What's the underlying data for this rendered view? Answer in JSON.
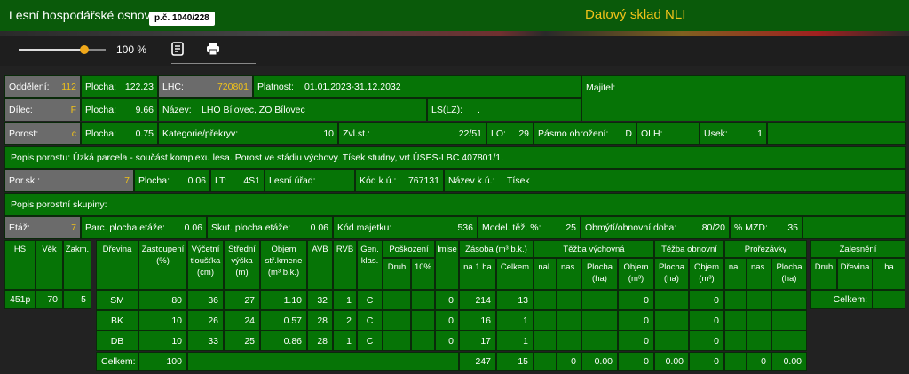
{
  "header": {
    "app_title": "Lesní hospodářské osnovy",
    "ref_badge": "p.č. 1040/228",
    "data_title": "Datový sklad NLI"
  },
  "toolbar": {
    "zoom": "100 %",
    "zoom_level": 1.0,
    "notes_icon": "notes-icon",
    "print_icon": "printer-icon"
  },
  "colors": {
    "accent": "#f0c21a",
    "cell": "#067406",
    "label_cell": "#6b6b6b"
  },
  "info": {
    "oddeleni_label": "Oddělení:",
    "oddeleni": "112",
    "plocha1_label": "Plocha:",
    "plocha1": "122.23",
    "lhc_label": "LHC:",
    "lhc": "720801",
    "platnost_label": "Platnost:",
    "platnost": "01.01.2023-31.12.2032",
    "majitel_label": "Majitel:",
    "dilec_label": "Dílec:",
    "dilec": "F",
    "plocha2_label": "Plocha:",
    "plocha2": "9.66",
    "nazev_label": "Název:",
    "nazev": "LHO Bílovec, ZO Bílovec",
    "ls_label": "LS(LZ):",
    "ls": ".",
    "porost_label": "Porost:",
    "porost": "c",
    "plocha3_label": "Plocha:",
    "plocha3": "0.75",
    "kategorie_label": "Kategorie/překryv:",
    "kategorie": "10",
    "zvlst_label": "Zvl.st.:",
    "zvlst": "22/51",
    "lo_label": "LO:",
    "lo": "29",
    "pasmo_label": "Pásmo ohrožení:",
    "pasmo": "D",
    "olh_label": "OLH:",
    "usek_label": "Úsek:",
    "usek": "1",
    "popis_porostu": "Popis porostu:  Úzká parcela - součást komplexu lesa. Porost ve stádiu výchovy. Tísek studny, vrt.ÚSES-LBC 407801/1.",
    "porsk_label": "Por.sk.:",
    "porsk": "7",
    "plocha4_label": "Plocha:",
    "plocha4": "0.06",
    "lt_label": "LT:",
    "lt": "4S1",
    "lesni_urad_label": "Lesní úřad:",
    "kod_ku_label": "Kód k.ú.:",
    "kod_ku": "767131",
    "nazev_ku_label": "Název k.ú.:",
    "nazev_ku": "Tísek",
    "popis_skupiny": "Popis porostní skupiny:",
    "etaz_label": "Etáž:",
    "etaz": "7",
    "parc_plocha_label": "Parc. plocha etáže:",
    "parc_plocha": "0.06",
    "skut_plocha_label": "Skut. plocha etáže:",
    "skut_plocha": "0.06",
    "kod_majetku_label": "Kód majetku:",
    "kod_majetku": "536",
    "model_tez_label": "Model. těž. %:",
    "model_tez": "25",
    "obmyti_label": "Obmýtí/obnovní doba:",
    "obmyti": "80/20",
    "mzd_label": "% MZD:",
    "mzd": "35"
  },
  "age_table": {
    "h_hs": "HS",
    "h_vek": "Věk",
    "h_zakm": "Zakm.",
    "hs": "451p",
    "vek": "70",
    "zakm": "5"
  },
  "species_table": {
    "h": {
      "dreviny": "Dřevina",
      "zastoupeni": "Zastoupení (%)",
      "tloustka": "Výčetní tloušťka (cm)",
      "vyska": "Střední výška (m)",
      "objem": "Objem stř.kmene (m³ b.k.)",
      "avb": "AVB",
      "rvb": "RVB",
      "gen": "Gen. klas.",
      "poskozeni": "Poškození",
      "druh": "Druh",
      "pct10": "10%",
      "imise": "Imise",
      "zasoba": "Zásoba (m³ b.k.)",
      "na1ha": "na 1 ha",
      "celkem": "Celkem",
      "tezba_vych": "Těžba výchovná",
      "nal": "nal.",
      "nas": "nas.",
      "plocha_ha": "Plocha (ha)",
      "objem_m3": "Objem (m³)",
      "tezba_obn": "Těžba obnovní",
      "prorezavky": "Prořezávky",
      "zalesneni": "Zalesnění",
      "ha": "ha"
    },
    "rows": [
      {
        "dreviny": "SM",
        "zastoupeni": "80",
        "tloustka": "36",
        "vyska": "27",
        "objem": "1.10",
        "avb": "32",
        "rvb": "1",
        "gen": "C",
        "imise": "0",
        "na1ha": "214",
        "celkem": "13",
        "tv_objem": "0",
        "to_objem": "0",
        "pr_plocha": ""
      },
      {
        "dreviny": "BK",
        "zastoupeni": "10",
        "tloustka": "26",
        "vyska": "24",
        "objem": "0.57",
        "avb": "28",
        "rvb": "2",
        "gen": "C",
        "imise": "0",
        "na1ha": "16",
        "celkem": "1",
        "tv_objem": "0",
        "to_objem": "0",
        "pr_plocha": ""
      },
      {
        "dreviny": "DB",
        "zastoupeni": "10",
        "tloustka": "33",
        "vyska": "25",
        "objem": "0.86",
        "avb": "28",
        "rvb": "1",
        "gen": "C",
        "imise": "0",
        "na1ha": "17",
        "celkem": "1",
        "tv_objem": "0",
        "to_objem": "0",
        "pr_plocha": ""
      }
    ],
    "total": {
      "label": "Celkem:",
      "zastoupeni": "100",
      "na1ha": "247",
      "celkem": "15",
      "tv_nal": "0",
      "tv_plocha": "0.00",
      "tv_objem": "0",
      "to_plocha": "0.00",
      "to_objem": "0",
      "pr_nas": "0",
      "pr_plocha": "0.00"
    },
    "zal_celkem": "Celkem:"
  }
}
